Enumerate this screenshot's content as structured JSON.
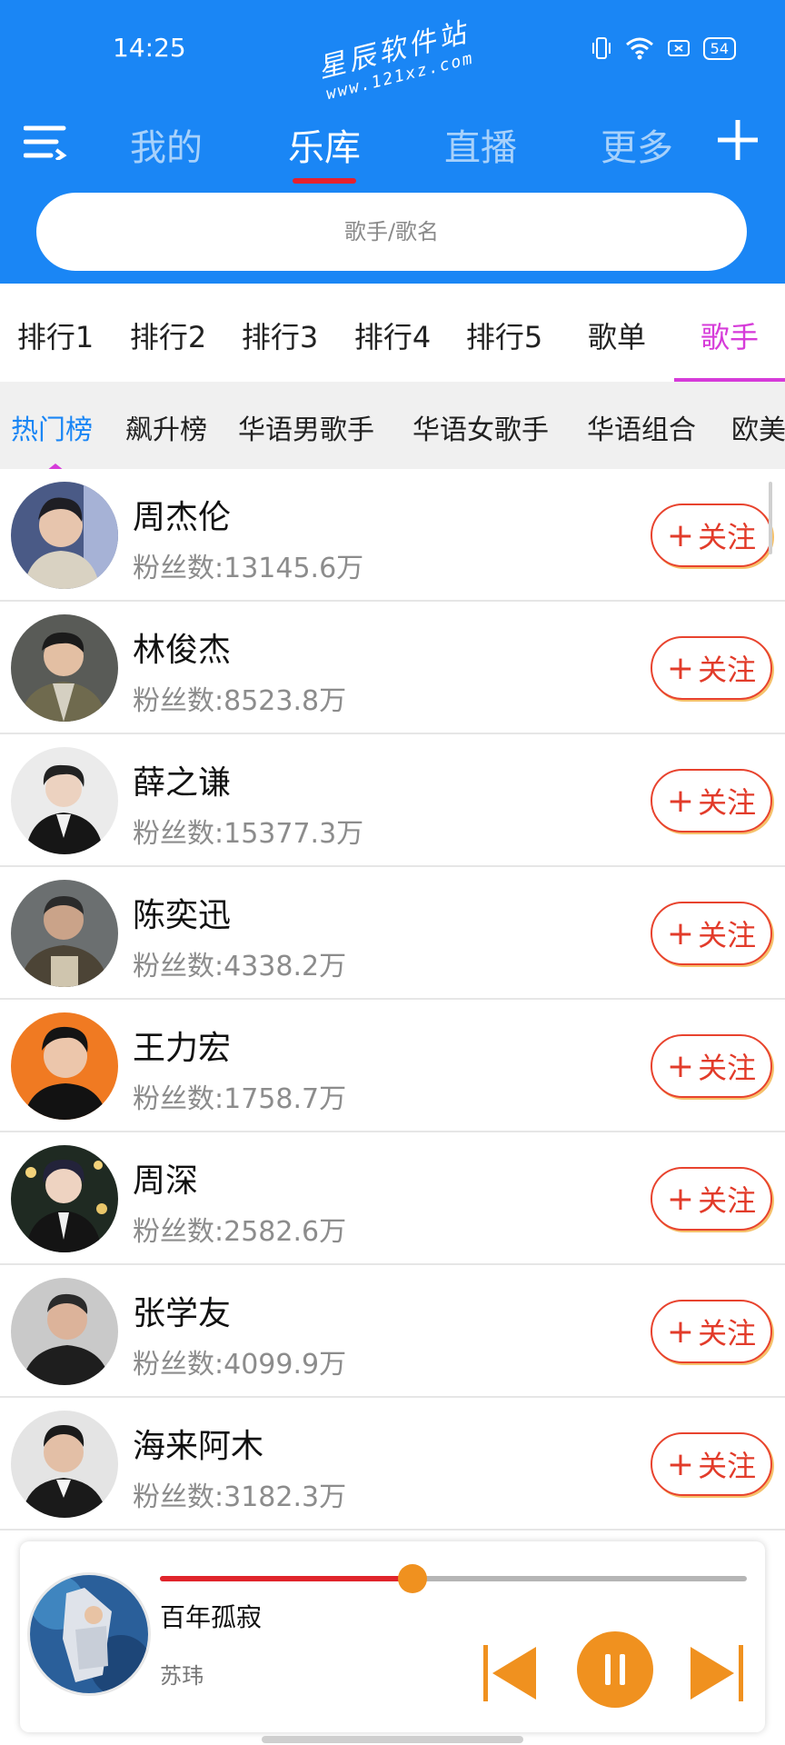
{
  "status_bar": {
    "time": "14:25",
    "battery": "54",
    "icons": [
      "vibrate-icon",
      "wifi-icon",
      "screen-icon",
      "battery-icon"
    ]
  },
  "watermark": {
    "text": "星辰软件站",
    "url": "www.121xz.com"
  },
  "top_nav": {
    "tabs": [
      {
        "label": "我的"
      },
      {
        "label": "乐库"
      },
      {
        "label": "直播"
      },
      {
        "label": "更多"
      }
    ],
    "active_index": 1
  },
  "search": {
    "placeholder": "歌手/歌名"
  },
  "rank_tabs": {
    "items": [
      {
        "label": "排行1"
      },
      {
        "label": "排行2"
      },
      {
        "label": "排行3"
      },
      {
        "label": "排行4"
      },
      {
        "label": "排行5"
      },
      {
        "label": "歌单"
      },
      {
        "label": "歌手"
      }
    ],
    "active_index": 6
  },
  "sub_tabs": {
    "items": [
      {
        "label": "热门榜"
      },
      {
        "label": "飙升榜"
      },
      {
        "label": "华语男歌手"
      },
      {
        "label": "华语女歌手"
      },
      {
        "label": "华语组合"
      },
      {
        "label": "欧美"
      }
    ],
    "active_index": 0
  },
  "singers": [
    {
      "name": "周杰伦",
      "fans": "粉丝数:13145.6万",
      "follow_label": "关注"
    },
    {
      "name": "林俊杰",
      "fans": "粉丝数:8523.8万",
      "follow_label": "关注"
    },
    {
      "name": "薛之谦",
      "fans": "粉丝数:15377.3万",
      "follow_label": "关注"
    },
    {
      "name": "陈奕迅",
      "fans": "粉丝数:4338.2万",
      "follow_label": "关注"
    },
    {
      "name": "王力宏",
      "fans": "粉丝数:1758.7万",
      "follow_label": "关注"
    },
    {
      "name": "周深",
      "fans": "粉丝数:2582.6万",
      "follow_label": "关注"
    },
    {
      "name": "张学友",
      "fans": "粉丝数:4099.9万",
      "follow_label": "关注"
    },
    {
      "name": "海来阿木",
      "fans": "粉丝数:3182.3万",
      "follow_label": "关注"
    }
  ],
  "player": {
    "title": "百年孤寂",
    "artist": "苏玮",
    "progress": 0.43,
    "state": "playing"
  },
  "colors": {
    "header_blue": "#1a86f5",
    "active_pink": "#d63bd9",
    "follow_red": "#e23b2a",
    "progress_red": "#e0242b",
    "control_orange": "#f0911f"
  }
}
